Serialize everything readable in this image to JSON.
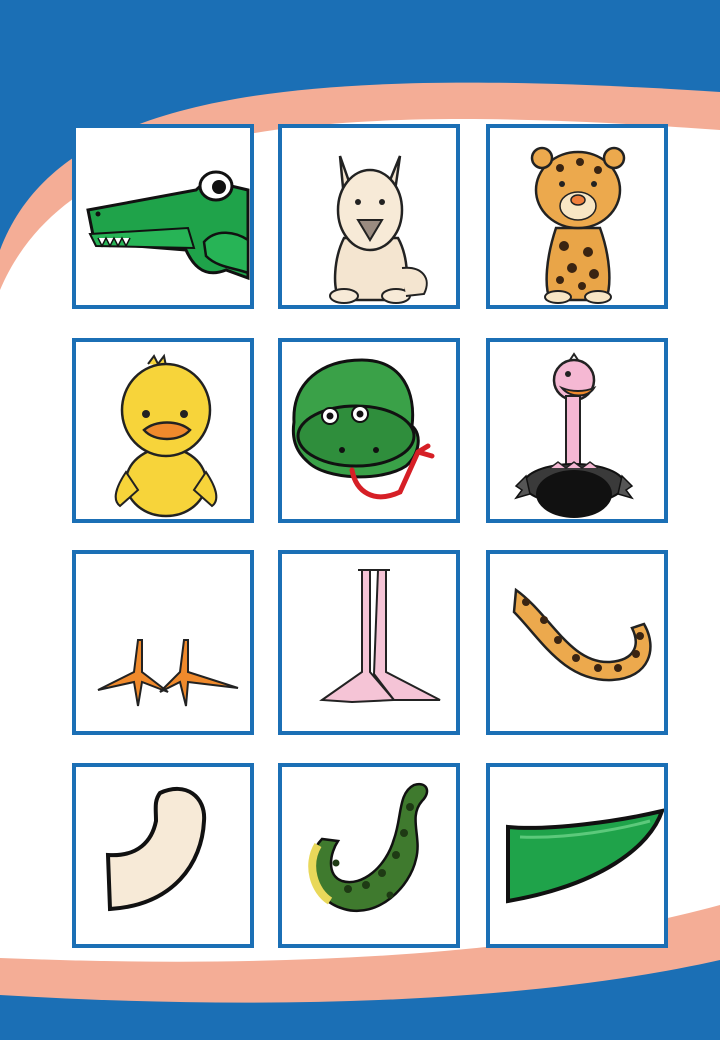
{
  "colors": {
    "frame_blue": "#1b6fb5",
    "band_salmon": "#f4ad96",
    "card_border": "#1b6fb5",
    "card_bg": "#ffffff"
  },
  "cards": [
    {
      "picture": "crocodile-head-icon"
    },
    {
      "picture": "llama-body-icon"
    },
    {
      "picture": "jaguar-body-icon"
    },
    {
      "picture": "duck-body-icon"
    },
    {
      "picture": "snake-head-icon"
    },
    {
      "picture": "ostrich-body-icon"
    },
    {
      "picture": "duck-feet-icon"
    },
    {
      "picture": "ostrich-legs-icon"
    },
    {
      "picture": "jaguar-tail-icon"
    },
    {
      "picture": "llama-tail-icon"
    },
    {
      "picture": "snake-tail-icon"
    },
    {
      "picture": "crocodile-tail-icon"
    }
  ]
}
